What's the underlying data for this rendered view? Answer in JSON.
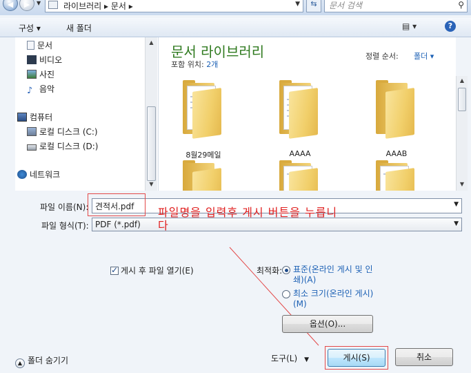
{
  "address": {
    "path": "라이브러리 ▸ 문서 ▸",
    "search_placeholder": "문서 검색"
  },
  "toolbar": {
    "organize": "구성 ▾",
    "new_folder": "새 폴더"
  },
  "nav": {
    "items": [
      {
        "label": "문서",
        "icon": "document-icon"
      },
      {
        "label": "비디오",
        "icon": "video-icon"
      },
      {
        "label": "사진",
        "icon": "picture-icon"
      },
      {
        "label": "음악",
        "icon": "music-icon"
      },
      {
        "label": "컴퓨터",
        "icon": "computer-icon"
      },
      {
        "label": "로컬 디스크 (C:)",
        "icon": "drive-icon"
      },
      {
        "label": "로컬 디스크 (D:)",
        "icon": "drive-icon"
      },
      {
        "label": "네트워크",
        "icon": "network-icon"
      }
    ]
  },
  "library": {
    "title": "문서 라이브러리",
    "includes_label": "포함 위치:",
    "includes_count": "2개",
    "sort_label": "정렬 순서:",
    "sort_value": "폴더 ▾"
  },
  "files": [
    {
      "name": "8월29메일"
    },
    {
      "name": "AAAA"
    },
    {
      "name": "AAAB"
    },
    {
      "name": ""
    },
    {
      "name": ""
    },
    {
      "name": ""
    }
  ],
  "form": {
    "filename_label": "파일 이름(N):",
    "filename_value": "견적서.pdf",
    "filetype_label": "파일 형식(T):",
    "filetype_value": "PDF (*.pdf)"
  },
  "annotation": {
    "text": "파일명을 입력후 게시 버튼을 누릅니다"
  },
  "options": {
    "open_after_publish": "게시 후 파일 열기(E)",
    "optimize_label": "최적화:",
    "standard": "표준(온라인 게시 및 인쇄)(A)",
    "minimum": "최소 크기(온라인 게시)(M)",
    "options_button": "옵션(O)..."
  },
  "footer": {
    "hide_folders": "폴더 숨기기",
    "tools": "도구(L)",
    "publish": "게시(S)",
    "cancel": "취소"
  }
}
